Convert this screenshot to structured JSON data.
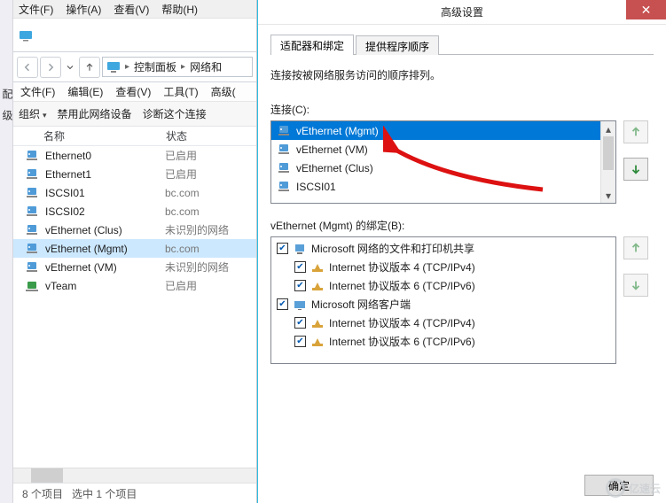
{
  "left_labels": [
    "配",
    "级"
  ],
  "explorer": {
    "menubar1": {
      "file": "文件(F)",
      "action": "操作(A)",
      "view": "查看(V)",
      "help": "帮助(H)"
    },
    "breadcrumb": {
      "root_icon": "monitor-icon",
      "items": [
        "控制面板",
        "网络和"
      ]
    },
    "menubar2": {
      "file": "文件(F)",
      "edit": "编辑(E)",
      "view": "查看(V)",
      "tools": "工具(T)",
      "advanced": "高级("
    },
    "toolbar": {
      "organize": "组织",
      "disable": "禁用此网络设备",
      "diagnose": "诊断这个连接"
    },
    "columns": {
      "name": "名称",
      "status": "状态"
    },
    "rows": [
      {
        "icon": "nic",
        "name": "Ethernet0",
        "status": "已启用"
      },
      {
        "icon": "nic",
        "name": "Ethernet1",
        "status": "已启用"
      },
      {
        "icon": "nic",
        "name": "ISCSI01",
        "status": "bc.com"
      },
      {
        "icon": "nic",
        "name": "ISCSI02",
        "status": "bc.com"
      },
      {
        "icon": "nic",
        "name": "vEthernet (Clus)",
        "status": "未识别的网络"
      },
      {
        "icon": "nic",
        "name": "vEthernet (Mgmt)",
        "status": "bc.com",
        "selected": true
      },
      {
        "icon": "nic",
        "name": "vEthernet (VM)",
        "status": "未识别的网络"
      },
      {
        "icon": "team",
        "name": "vTeam",
        "status": "已启用"
      }
    ],
    "status_left": "8 个项目",
    "status_right": "选中 1 个项目"
  },
  "dialog": {
    "title": "高级设置",
    "close": "✕",
    "tabs": {
      "t1": "适配器和绑定",
      "t2": "提供程序顺序"
    },
    "desc": "连接按被网络服务访问的顺序排列。",
    "conn_label": "连接(C):",
    "connections": [
      {
        "name": "vEthernet (Mgmt)",
        "selected": true
      },
      {
        "name": "vEthernet (VM)"
      },
      {
        "name": "vEthernet (Clus)"
      },
      {
        "name": "ISCSI01"
      }
    ],
    "bind_label": "vEthernet (Mgmt) 的绑定(B):",
    "bindings": [
      {
        "level": 0,
        "checked": true,
        "icon": "share",
        "text": "Microsoft 网络的文件和打印机共享"
      },
      {
        "level": 1,
        "checked": true,
        "icon": "proto",
        "text": "Internet 协议版本 4 (TCP/IPv4)"
      },
      {
        "level": 1,
        "checked": true,
        "icon": "proto",
        "text": "Internet 协议版本 6 (TCP/IPv6)"
      },
      {
        "level": 0,
        "checked": true,
        "icon": "client",
        "text": "Microsoft 网络客户端"
      },
      {
        "level": 1,
        "checked": true,
        "icon": "proto",
        "text": "Internet 协议版本 4 (TCP/IPv4)"
      },
      {
        "level": 1,
        "checked": true,
        "icon": "proto",
        "text": "Internet 协议版本 6 (TCP/IPv6)"
      }
    ],
    "buttons": {
      "ok": "确定"
    }
  },
  "watermark": "亿速云"
}
